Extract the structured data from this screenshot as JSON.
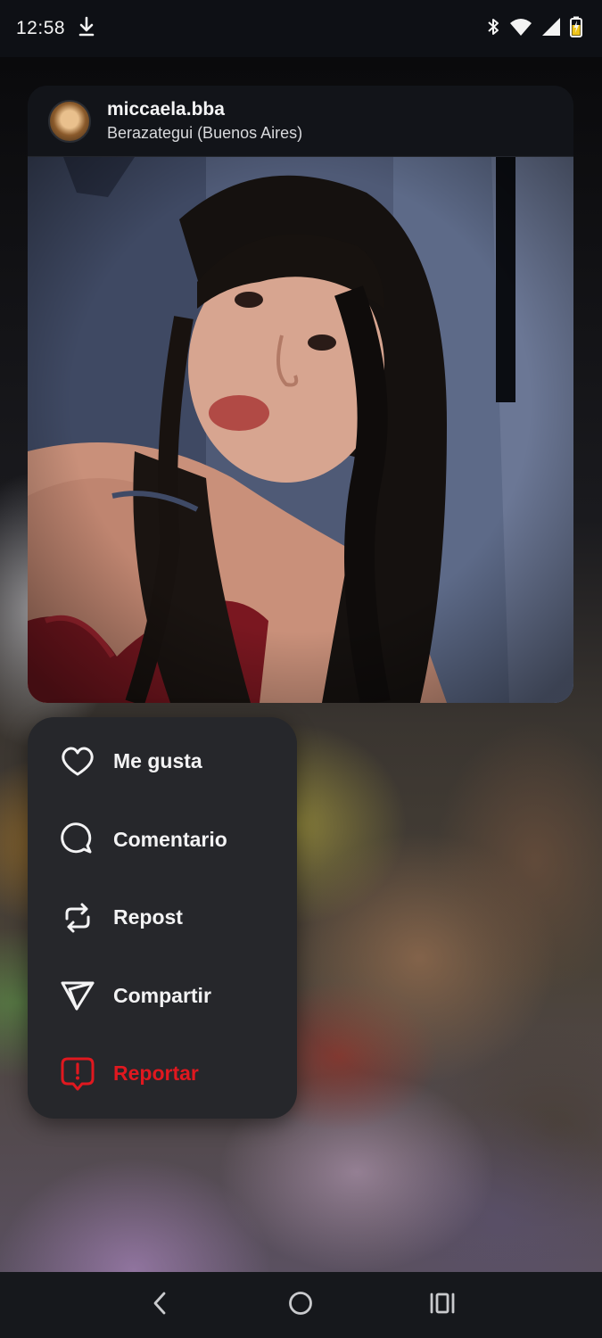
{
  "status_bar": {
    "time": "12:58",
    "left_icons": [
      "download-icon"
    ],
    "right_icons": [
      "bluetooth-icon",
      "wifi-icon",
      "signal-icon",
      "battery-charging-icon"
    ]
  },
  "post": {
    "username": "miccaela.bba",
    "location": "Berazategui (Buenos Aires)"
  },
  "menu": {
    "items": [
      {
        "label": "Me gusta",
        "icon": "heart-icon"
      },
      {
        "label": "Comentario",
        "icon": "comment-icon"
      },
      {
        "label": "Repost",
        "icon": "repost-icon"
      },
      {
        "label": "Compartir",
        "icon": "share-icon"
      },
      {
        "label": "Reportar",
        "icon": "report-icon"
      }
    ]
  },
  "nav": {
    "buttons": [
      "back-icon",
      "home-icon",
      "recents-icon"
    ]
  },
  "colors": {
    "menu_background": "#26272b",
    "danger": "#e0181f",
    "text": "#f3f3f4"
  }
}
